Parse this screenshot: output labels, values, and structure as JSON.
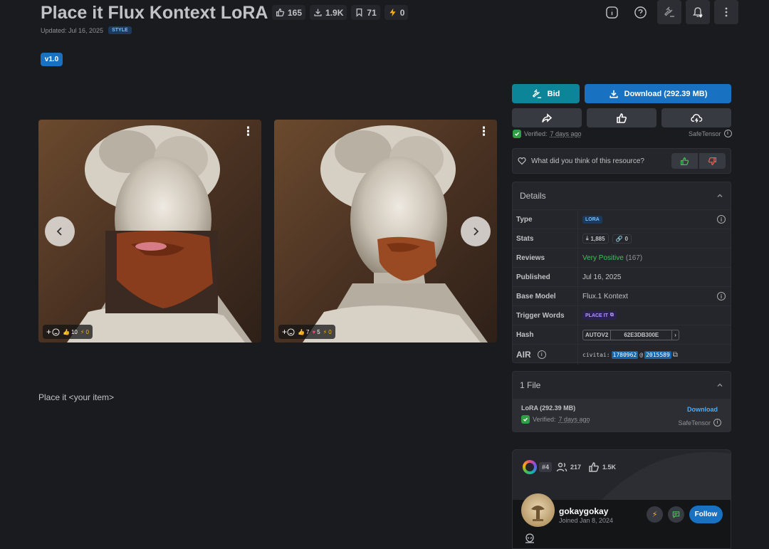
{
  "header": {
    "title": "Place it Flux Kontext LoRA",
    "stats": {
      "likes": "165",
      "downloads": "1.9K",
      "collected": "71",
      "buzz": "0"
    },
    "updated": "Updated: Jul 16, 2025",
    "category": "STYLE",
    "version": "v1.0"
  },
  "gallery": {
    "left": {
      "likes": "10",
      "buzz": "0"
    },
    "right": {
      "likes": "7",
      "hearts": "5",
      "buzz": "0"
    }
  },
  "description": "Place it <your item>",
  "actions": {
    "bid": "Bid",
    "download": "Download (292.39 MB)",
    "verified_label": "Verified:",
    "verified_when": "7 days ago",
    "safetensor": "SafeTensor"
  },
  "feedback": {
    "question": "What did you think of this resource?"
  },
  "details": {
    "heading": "Details",
    "type_k": "Type",
    "type_v": "LORA",
    "stats_k": "Stats",
    "stats_downloads": "1,885",
    "stats_links": "0",
    "reviews_k": "Reviews",
    "reviews_v": "Very Positive",
    "reviews_count": "(167)",
    "published_k": "Published",
    "published_v": "Jul 16, 2025",
    "base_k": "Base Model",
    "base_v": "Flux.1 Kontext",
    "trigger_k": "Trigger Words",
    "trigger_v": "PLACE IT",
    "hash_k": "Hash",
    "hash_type": "AUTOV2",
    "hash_v": "62E3DB300E",
    "air_k": "AIR",
    "air_prefix": "civitai:",
    "air_model": "1780962",
    "air_at": "@",
    "air_version": "2015589"
  },
  "files": {
    "heading": "1 File",
    "name": "LoRA (292.39 MB)",
    "download": "Download",
    "verified_label": "Verified:",
    "verified_when": "7 days ago",
    "safetensor": "SafeTensor"
  },
  "creator": {
    "rank": "#4",
    "followers": "217",
    "likes": "1.5K",
    "name": "gokaygokay",
    "joined": "Joined Jan 8, 2024",
    "follow": "Follow"
  },
  "colors": {
    "bid": "#0c8599",
    "download": "#1971c2",
    "positive": "#40c057",
    "buzz": "#fab005"
  }
}
